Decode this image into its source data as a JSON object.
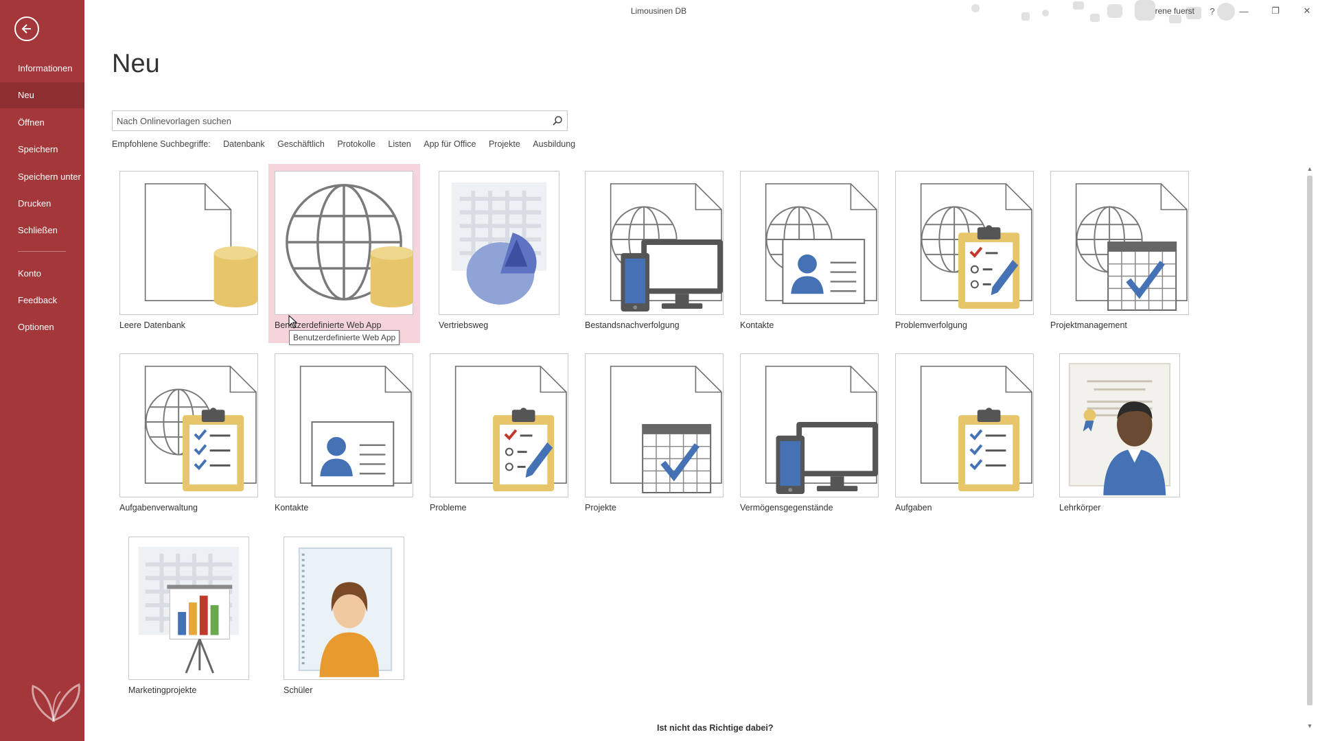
{
  "window": {
    "title": "Limousinen DB",
    "user": "rene fuerst",
    "help_label": "?",
    "minimize_label": "—",
    "restore_label": "❐",
    "close_label": "✕"
  },
  "sidebar": {
    "items": [
      {
        "label": "Informationen"
      },
      {
        "label": "Neu"
      },
      {
        "label": "Öffnen"
      },
      {
        "label": "Speichern"
      },
      {
        "label": "Speichern unter"
      },
      {
        "label": "Drucken"
      },
      {
        "label": "Schließen"
      },
      {
        "label": "Konto"
      },
      {
        "label": "Feedback"
      },
      {
        "label": "Optionen"
      }
    ],
    "active": "Neu"
  },
  "page": {
    "title": "Neu",
    "search_placeholder": "Nach Onlinevorlagen suchen",
    "suggested_label": "Empfohlene Suchbegriffe:",
    "suggested": [
      "Datenbank",
      "Geschäftlich",
      "Protokolle",
      "Listen",
      "App für Office",
      "Projekte",
      "Ausbildung"
    ]
  },
  "templates": [
    {
      "label": "Leere Datenbank",
      "icon": "blank-database-icon"
    },
    {
      "label": "Benutzerdefinierte Web App",
      "icon": "web-app-icon"
    },
    {
      "label": "Vertriebsweg",
      "icon": "pie-chart-icon"
    },
    {
      "label": "Bestandsnachverfolgung",
      "icon": "web-devices-icon"
    },
    {
      "label": "Kontakte",
      "icon": "web-contact-card-icon"
    },
    {
      "label": "Problemverfolgung",
      "icon": "web-issue-clipboard-icon"
    },
    {
      "label": "Projektmanagement",
      "icon": "web-calendar-icon"
    },
    {
      "label": "Aufgabenverwaltung",
      "icon": "web-task-clipboard-icon"
    },
    {
      "label": "Kontakte",
      "icon": "contact-card-icon"
    },
    {
      "label": "Probleme",
      "icon": "issue-clipboard-icon"
    },
    {
      "label": "Projekte",
      "icon": "calendar-icon"
    },
    {
      "label": "Vermögensgegenstände",
      "icon": "devices-icon"
    },
    {
      "label": "Aufgaben",
      "icon": "task-clipboard-icon"
    },
    {
      "label": "Lehrkörper",
      "icon": "teacher-icon"
    },
    {
      "label": "Marketingprojekte",
      "icon": "presentation-chart-icon"
    },
    {
      "label": "Schüler",
      "icon": "student-icon"
    }
  ],
  "tooltip": "Benutzerdefinierte Web App",
  "bottom_text": "Ist nicht das Richtige dabei?",
  "colors": {
    "sidebar": "#a4373a",
    "sidebar_active": "#8f2e31",
    "gold": "#e7c66b",
    "blue": "#4472b4",
    "highlight": "#f6d4dc"
  }
}
